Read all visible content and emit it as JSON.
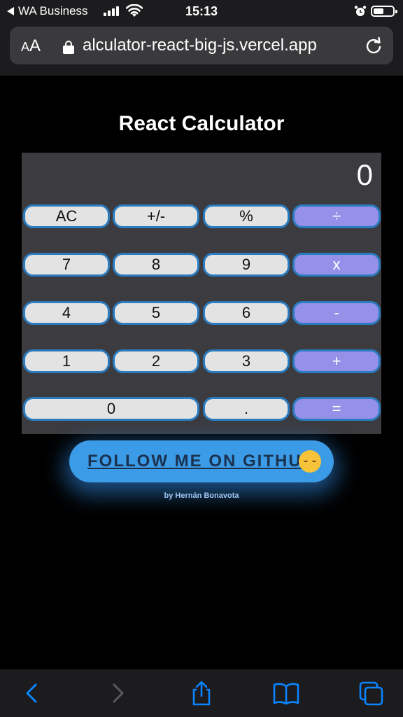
{
  "status": {
    "back_app": "WA Business",
    "time": "15:13",
    "battery_level": 0.55
  },
  "browser": {
    "text_size_small": "A",
    "text_size_large": "A",
    "url": "alculator-react-big-js.vercel.app"
  },
  "page": {
    "title": "React Calculator",
    "display": "0",
    "keys": [
      {
        "label": "AC",
        "type": "fn"
      },
      {
        "label": "+/-",
        "type": "fn"
      },
      {
        "label": "%",
        "type": "fn"
      },
      {
        "label": "÷",
        "type": "op"
      },
      {
        "label": "7",
        "type": "num"
      },
      {
        "label": "8",
        "type": "num"
      },
      {
        "label": "9",
        "type": "num"
      },
      {
        "label": "x",
        "type": "op"
      },
      {
        "label": "4",
        "type": "num"
      },
      {
        "label": "5",
        "type": "num"
      },
      {
        "label": "6",
        "type": "num"
      },
      {
        "label": "-",
        "type": "op"
      },
      {
        "label": "1",
        "type": "num"
      },
      {
        "label": "2",
        "type": "num"
      },
      {
        "label": "3",
        "type": "num"
      },
      {
        "label": "+",
        "type": "op"
      },
      {
        "label": "0",
        "type": "num"
      },
      {
        "label": ".",
        "type": "num"
      },
      {
        "label": "=",
        "type": "op"
      }
    ],
    "github_button": "FOLLOW ME ON GITHUB",
    "github_emoji": "smiling-face-with-hearts",
    "author": "by Hernán Bonavota"
  },
  "toolbar": [
    "back-icon",
    "forward-icon",
    "share-icon",
    "bookmarks-icon",
    "tabs-icon"
  ],
  "colors": {
    "accent": "#3c9be6",
    "operator_key": "#9590e8",
    "key": "#e3e3e3",
    "key_border": "#2a7bbf",
    "calculator_bg": "#3b3b40",
    "ios_blue": "#0a84ff"
  }
}
